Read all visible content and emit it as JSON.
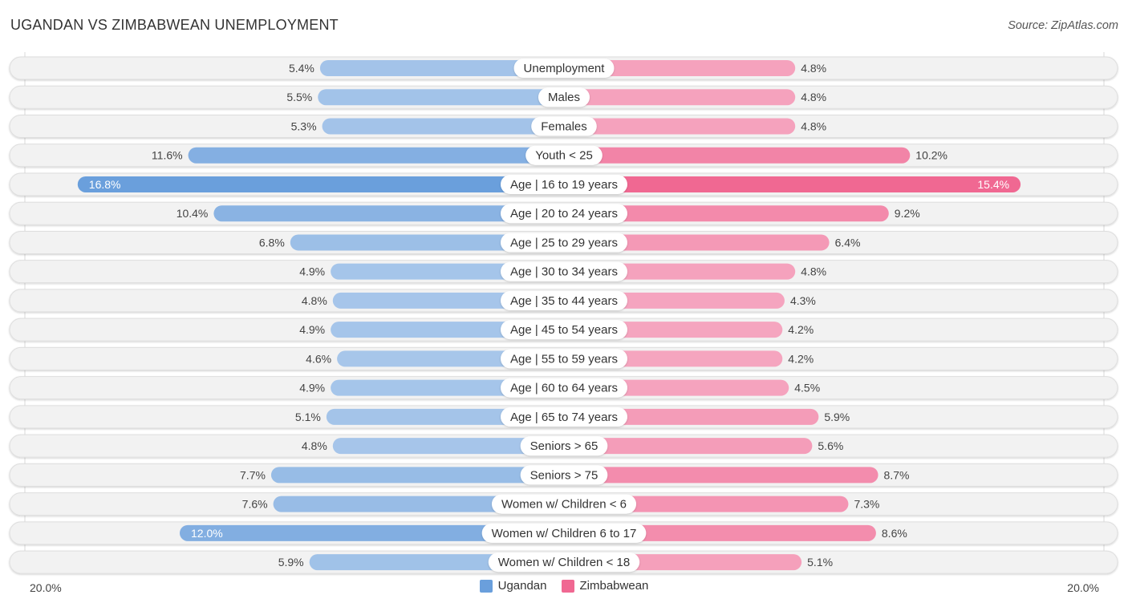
{
  "header": {
    "title": "UGANDAN VS ZIMBABWEAN UNEMPLOYMENT",
    "source": "Source: ZipAtlas.com"
  },
  "colors": {
    "ugandan": "#6a9fdc",
    "ugandan_light": "#a7c6ea",
    "zimbabwean": "#f06892",
    "zimbabwean_light": "#f5a5bf",
    "row_bg": "#f2f2f2"
  },
  "chart_data": {
    "type": "bar",
    "orientation": "horizontal-diverging",
    "title": "UGANDAN VS ZIMBABWEAN UNEMPLOYMENT",
    "categories": [
      "Unemployment",
      "Males",
      "Females",
      "Youth < 25",
      "Age | 16 to 19 years",
      "Age | 20 to 24 years",
      "Age | 25 to 29 years",
      "Age | 30 to 34 years",
      "Age | 35 to 44 years",
      "Age | 45 to 54 years",
      "Age | 55 to 59 years",
      "Age | 60 to 64 years",
      "Age | 65 to 74 years",
      "Seniors > 65",
      "Seniors > 75",
      "Women w/ Children < 6",
      "Women w/ Children 6 to 17",
      "Women w/ Children < 18"
    ],
    "series": [
      {
        "name": "Ugandan",
        "side": "left",
        "values": [
          5.4,
          5.5,
          5.3,
          11.6,
          16.8,
          10.4,
          6.8,
          4.9,
          4.8,
          4.9,
          4.6,
          4.9,
          5.1,
          4.8,
          7.7,
          7.6,
          12.0,
          5.9
        ],
        "labels": [
          "5.4%",
          "5.5%",
          "5.3%",
          "11.6%",
          "16.8%",
          "10.4%",
          "6.8%",
          "4.9%",
          "4.8%",
          "4.9%",
          "4.6%",
          "4.9%",
          "5.1%",
          "4.8%",
          "7.7%",
          "7.6%",
          "12.0%",
          "5.9%"
        ]
      },
      {
        "name": "Zimbabwean",
        "side": "right",
        "values": [
          4.8,
          4.8,
          4.8,
          10.2,
          15.4,
          9.2,
          6.4,
          4.8,
          4.3,
          4.2,
          4.2,
          4.5,
          5.9,
          5.6,
          8.7,
          7.3,
          8.6,
          5.1
        ],
        "labels": [
          "4.8%",
          "4.8%",
          "4.8%",
          "10.2%",
          "15.4%",
          "9.2%",
          "6.4%",
          "4.8%",
          "4.3%",
          "4.2%",
          "4.2%",
          "4.5%",
          "5.9%",
          "5.6%",
          "8.7%",
          "7.3%",
          "8.6%",
          "5.1%"
        ]
      }
    ],
    "xlim": [
      -20,
      20
    ],
    "axis_labels": {
      "left": "20.0%",
      "right": "20.0%"
    },
    "unit": "%",
    "legend": {
      "position": "bottom-center",
      "entries": [
        "Ugandan",
        "Zimbabwean"
      ]
    },
    "grid": false
  }
}
